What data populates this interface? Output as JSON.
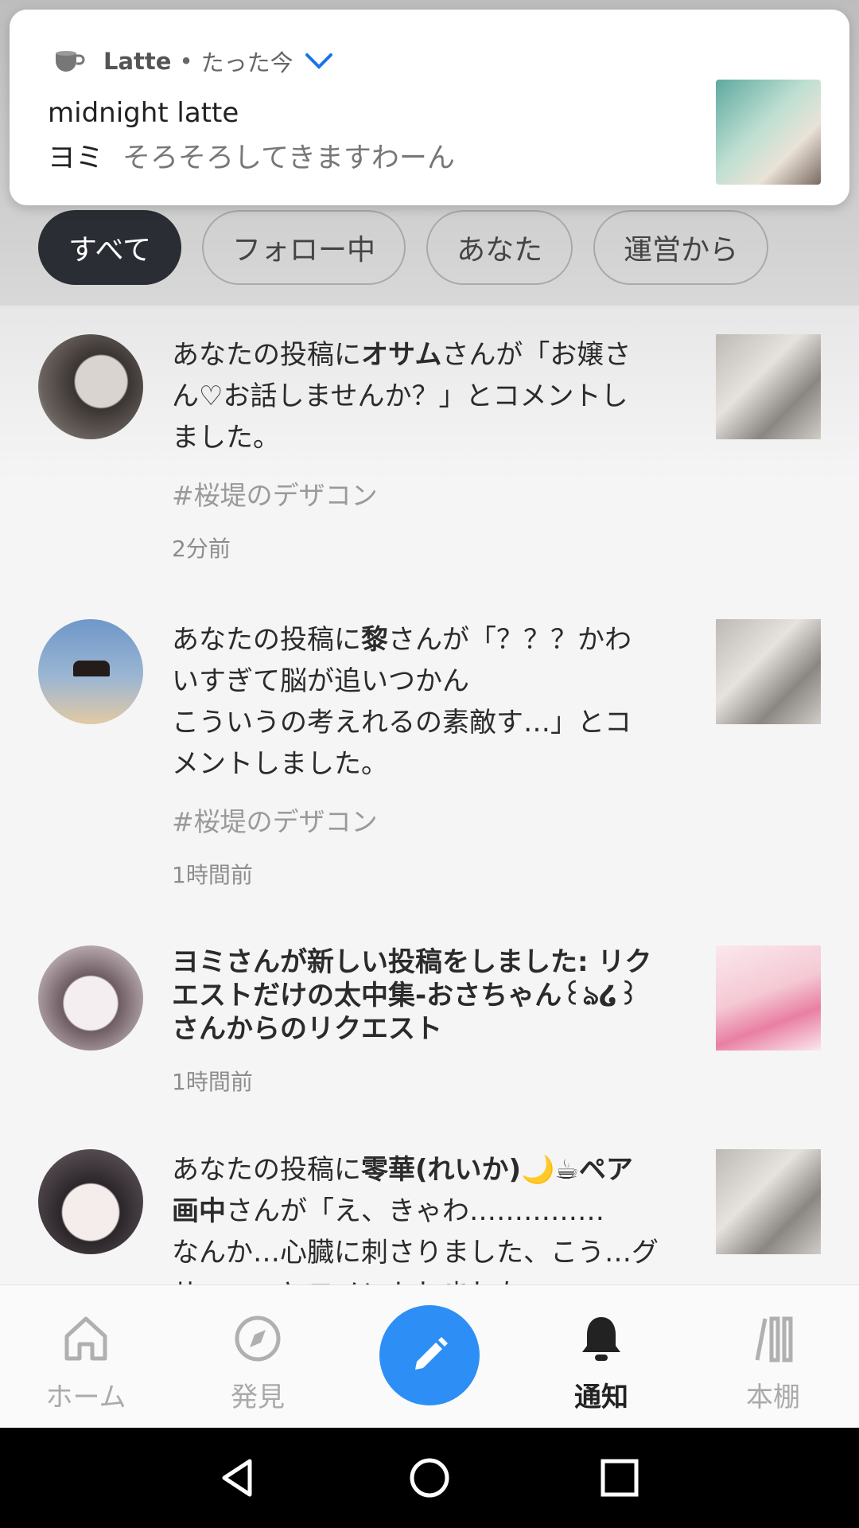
{
  "notification": {
    "app": "Latte",
    "separator": "•",
    "time": "たった今",
    "title": "midnight latte",
    "sender": "ヨミ",
    "text": "そろそろしてきますわーん"
  },
  "filters": [
    "すべて",
    "フォロー中",
    "あなた",
    "運営から"
  ],
  "items": [
    {
      "pre": "あなたの投稿に",
      "user": "オサム",
      "post": "さんが「お嬢さ\nん♡お話しませんか？」とコメントし\nました。",
      "tag": "#桜堤のデザコン",
      "time": "2分前"
    },
    {
      "pre": "あなたの投稿に",
      "user": "黎",
      "post": "さんが「？？？かわ\nいすぎて脳が追いつかん\nこういうの考えれるの素敵す…」とコ\nメントしました。",
      "tag": "#桜堤のデザコン",
      "time": "1時間前"
    },
    {
      "text": "ヨミさんが新しい投稿をしました: リク\nエストだけの太中集-おさちゃん꒰ঌ໒꒱\nさんからのリクエスト",
      "time": "1時間前"
    },
    {
      "pre": "あなたの投稿に",
      "user": "零華(れいか)🌙☕ペア\n画中",
      "post": "さんが「え、きゃわ……………\nなんか…心臓に刺さりました、こう…グ\nサ……」とコメントしました。"
    }
  ],
  "nav": {
    "home": "ホーム",
    "discover": "発見",
    "notifications": "通知",
    "bookshelf": "本棚"
  },
  "colors": {
    "accent": "#2d8ff5",
    "chip_active": "#2a2d33"
  }
}
